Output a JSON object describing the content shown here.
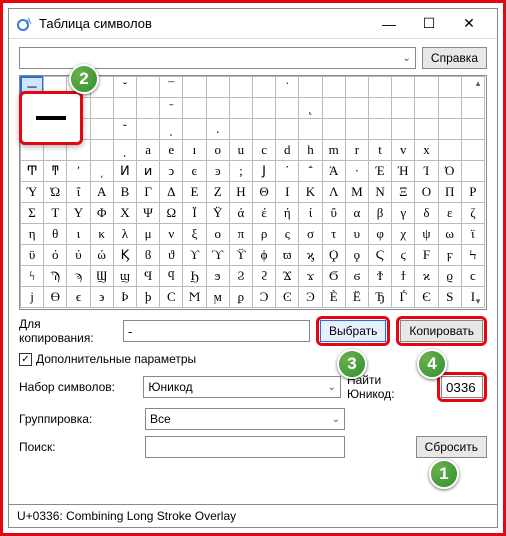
{
  "window": {
    "title": "Таблица символов"
  },
  "top": {
    "help": "Справка"
  },
  "copyrow": {
    "label": "Для копирования:",
    "value": "-",
    "select_btn": "Выбрать",
    "copy_btn": "Копировать"
  },
  "adv": {
    "checkbox_label": "Дополнительные параметры",
    "checked": "✓"
  },
  "charset": {
    "label": "Набор символов:",
    "value": "Юникод",
    "find_label": "Найти Юникод:",
    "find_value": "0336"
  },
  "group": {
    "label": "Группировка:",
    "value": "Все"
  },
  "search": {
    "label": "Поиск:",
    "reset": "Сбросить"
  },
  "status": "U+0336: Combining Long Stroke Overlay",
  "badges": {
    "b1": "1",
    "b2": "2",
    "b3": "3",
    "b4": "4"
  },
  "arrow": "⌄",
  "grid": [
    [
      "─",
      "",
      "",
      "",
      "˘",
      "",
      "¯",
      "",
      "",
      "",
      "",
      "˙",
      "",
      "",
      "",
      "",
      "",
      "",
      "",
      ""
    ],
    [
      "",
      "",
      "",
      "",
      "",
      "",
      "ˉ",
      "",
      "",
      "",
      "",
      "",
      "˛",
      "",
      "",
      "",
      "",
      "",
      "",
      ""
    ],
    [
      "",
      "",
      "",
      "",
      "͂",
      "",
      "ͅ",
      "",
      ".",
      "",
      "",
      "",
      "",
      "",
      "",
      "",
      "",
      "",
      "",
      ""
    ],
    [
      "",
      "",
      "",
      "",
      "ͺ",
      "a",
      "e",
      "ı",
      "o",
      "u",
      "c",
      "d",
      "h",
      "m",
      "r",
      "t",
      "v",
      "x",
      "",
      ""
    ],
    [
      "Ͳ",
      "ͳ",
      "ʹ",
      "͵",
      "Ͷ",
      "ͷ",
      "ͻ",
      "ͼ",
      "ͽ",
      ";",
      "Ϳ",
      "΄",
      "΅",
      "Ά",
      "·",
      "Έ",
      "Ή",
      "Ί",
      "Ό",
      ""
    ],
    [
      "Ύ",
      "Ώ",
      "ΐ",
      "Α",
      "Β",
      "Γ",
      "Δ",
      "Ε",
      "Ζ",
      "Η",
      "Θ",
      "Ι",
      "Κ",
      "Λ",
      "Μ",
      "Ν",
      "Ξ",
      "Ο",
      "Π",
      "Ρ"
    ],
    [
      "Σ",
      "Τ",
      "Υ",
      "Φ",
      "Χ",
      "Ψ",
      "Ω",
      "Ϊ",
      "Ϋ",
      "ά",
      "έ",
      "ή",
      "ί",
      "ΰ",
      "α",
      "β",
      "γ",
      "δ",
      "ε",
      "ζ"
    ],
    [
      "η",
      "θ",
      "ι",
      "κ",
      "λ",
      "μ",
      "ν",
      "ξ",
      "ο",
      "π",
      "ρ",
      "ς",
      "σ",
      "τ",
      "υ",
      "φ",
      "χ",
      "ψ",
      "ω",
      "ϊ"
    ],
    [
      "ϋ",
      "ό",
      "ύ",
      "ώ",
      "Ϗ",
      "ϐ",
      "ϑ",
      "ϒ",
      "ϓ",
      "ϔ",
      "ϕ",
      "ϖ",
      "ϗ",
      "Ϙ",
      "ϙ",
      "Ϛ",
      "ϛ",
      "Ϝ",
      "ϝ",
      "Ϟ"
    ],
    [
      "ϟ",
      "Ϡ",
      "ϡ",
      "Ϣ",
      "ϣ",
      "Ϥ",
      "ϥ",
      "Ϧ",
      "ϧ",
      "Ϩ",
      "ϩ",
      "Ϫ",
      "ϫ",
      "Ϭ",
      "ϭ",
      "Ϯ",
      "ϯ",
      "ϰ",
      "ϱ",
      "ϲ"
    ],
    [
      "ϳ",
      "ϴ",
      "ϵ",
      "϶",
      "Ϸ",
      "ϸ",
      "Ϲ",
      "Ϻ",
      "ϻ",
      "ϼ",
      "Ͻ",
      "Ͼ",
      "Ͽ",
      "Ѐ",
      "Ё",
      "Ђ",
      "Ѓ",
      "Є",
      "Ѕ",
      "І"
    ]
  ]
}
